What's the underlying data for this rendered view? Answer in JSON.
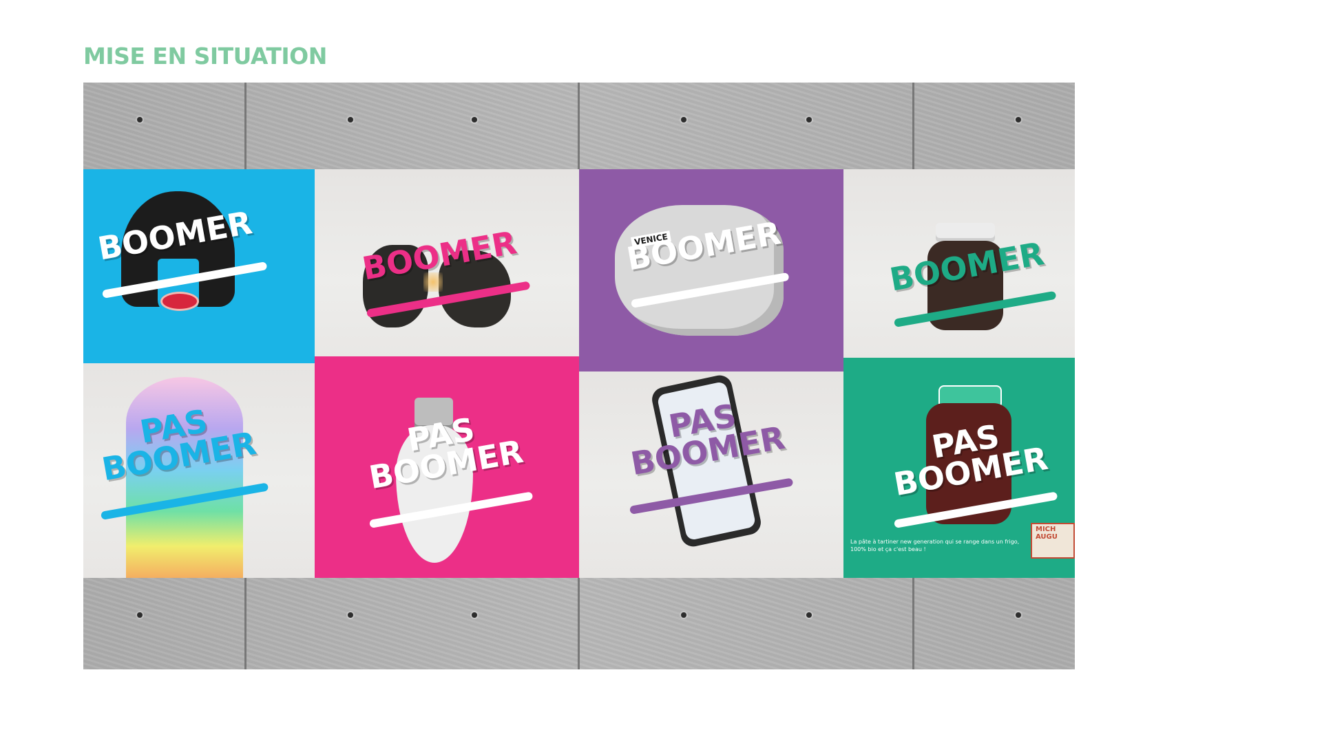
{
  "page": {
    "title": "MISE EN SITUATION"
  },
  "posters": [
    {
      "headline": "BOOMER",
      "background": "#1ab4e6",
      "accent": "#ffffff",
      "object": "black-bob-wig"
    },
    {
      "headline": "BOOMER",
      "background": "#e6e4e2",
      "accent": "#ec2f87",
      "object": "broken-stone"
    },
    {
      "headline": "BOOMER",
      "background": "#8e5aa6",
      "accent": "#ffffff",
      "object": "crumpled-map-venice",
      "object_text": "VENICE"
    },
    {
      "headline": "BOOMER",
      "background": "#ececea",
      "accent": "#1eab86",
      "object": "spread-jar"
    },
    {
      "headline": "PAS\nBOOMER",
      "background": "#ececea",
      "accent": "#1ab4e6",
      "object": "rainbow-hair"
    },
    {
      "headline": "PAS\nBOOMER",
      "background": "#ec2f87",
      "accent": "#ffffff",
      "object": "light-bulb"
    },
    {
      "headline": "PAS\nBOOMER",
      "background": "#ececea",
      "accent": "#8e5aa6",
      "object": "smartphone"
    },
    {
      "headline": "PAS\nBOOMER",
      "background": "#1eab86",
      "accent": "#ffffff",
      "object": "spread-jar-organic",
      "tagline": "La pâte à tartiner new generation qui se range dans un frigo, 100% bio et ça c'est beau !",
      "brand_logo": "MICH AUGU"
    }
  ]
}
